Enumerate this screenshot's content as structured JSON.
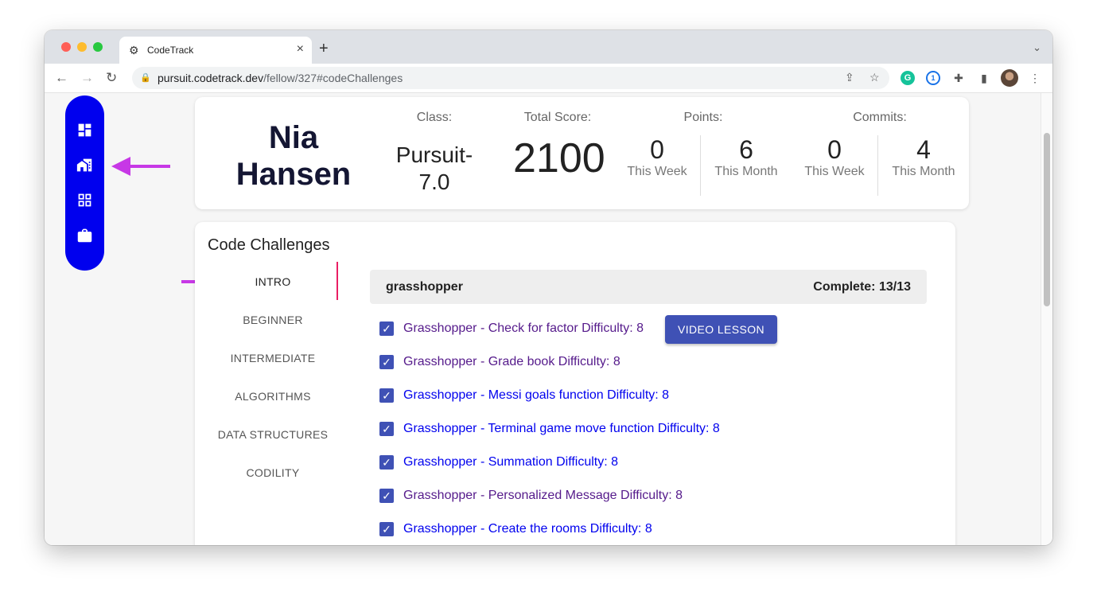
{
  "browser": {
    "tab_title": "CodeTrack",
    "url_host": "pursuit.codetrack.dev",
    "url_path": "/fellow/327#codeChallenges"
  },
  "sidenav": {
    "items": [
      {
        "icon": "dashboard-icon"
      },
      {
        "icon": "home-work-icon"
      },
      {
        "icon": "apps-grid-icon"
      },
      {
        "icon": "briefcase-icon"
      }
    ],
    "bg_color": "#0000ee"
  },
  "profile": {
    "name": "Nia Hansen",
    "class_label": "Class:",
    "class_value": "Pursuit-7.0",
    "total_score_label": "Total Score:",
    "total_score": "2100",
    "points_label": "Points:",
    "commits_label": "Commits:",
    "points": [
      {
        "value": "0",
        "period": "This Week"
      },
      {
        "value": "6",
        "period": "This Month"
      }
    ],
    "commits": [
      {
        "value": "0",
        "period": "This Week"
      },
      {
        "value": "4",
        "period": "This Month"
      }
    ]
  },
  "challenges": {
    "title": "Code Challenges",
    "categories": [
      "INTRO",
      "BEGINNER",
      "INTERMEDIATE",
      "ALGORITHMS",
      "DATA STRUCTURES",
      "CODILITY"
    ],
    "active_category": "INTRO",
    "group": {
      "name": "grasshopper",
      "complete": "Complete: 13/13"
    },
    "video_lesson_label": "VIDEO LESSON",
    "items": [
      {
        "label": "Grasshopper - Check for factor Difficulty: 8",
        "visited": true
      },
      {
        "label": "Grasshopper - Grade book Difficulty: 8",
        "visited": true
      },
      {
        "label": "Grasshopper - Messi goals function Difficulty: 8",
        "visited": false
      },
      {
        "label": "Grasshopper - Terminal game move function Difficulty: 8",
        "visited": false
      },
      {
        "label": "Grasshopper - Summation Difficulty: 8",
        "visited": false
      },
      {
        "label": "Grasshopper - Personalized Message Difficulty: 8",
        "visited": true
      },
      {
        "label": "Grasshopper - Create the rooms Difficulty: 8",
        "visited": false
      }
    ]
  },
  "colors": {
    "annotation_arrow": "#c738e6",
    "active_indicator": "#e91e63",
    "button": "#3f51b5"
  }
}
